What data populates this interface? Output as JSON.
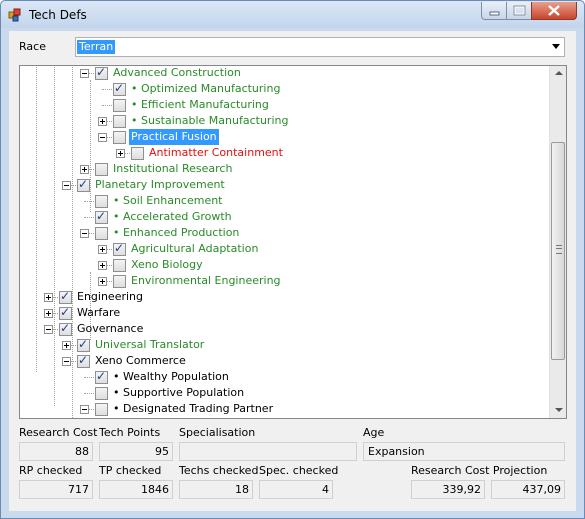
{
  "window": {
    "title": "Tech Defs"
  },
  "race": {
    "label": "Race",
    "value": "Terran"
  },
  "tree_nodes": [
    {
      "text": "Advanced Construction",
      "checked": true,
      "expander": "minus",
      "style": "green"
    },
    {
      "text": "• Optimized Manufacturing",
      "checked": true,
      "expander": "",
      "style": "green"
    },
    {
      "text": "• Efficient Manufacturing",
      "checked": false,
      "expander": "",
      "style": "green"
    },
    {
      "text": "• Sustainable Manufacturing",
      "checked": false,
      "expander": "plus",
      "style": "green"
    },
    {
      "text": "Practical Fusion",
      "checked": false,
      "expander": "minus",
      "style": "selected"
    },
    {
      "text": "Antimatter Containment",
      "checked": false,
      "expander": "plus",
      "style": "red"
    },
    {
      "text": "Institutional Research",
      "checked": false,
      "expander": "plus",
      "style": "green"
    },
    {
      "text": "Planetary Improvement",
      "checked": true,
      "expander": "minus",
      "style": "green"
    },
    {
      "text": "• Soil Enhancement",
      "checked": false,
      "expander": "",
      "style": "green"
    },
    {
      "text": "• Accelerated Growth",
      "checked": true,
      "expander": "",
      "style": "green"
    },
    {
      "text": "• Enhanced Production",
      "checked": false,
      "expander": "minus",
      "style": "green"
    },
    {
      "text": "Agricultural Adaptation",
      "checked": true,
      "expander": "plus",
      "style": "green"
    },
    {
      "text": "Xeno Biology",
      "checked": false,
      "expander": "plus",
      "style": "green"
    },
    {
      "text": "Environmental Engineering",
      "checked": false,
      "expander": "plus",
      "style": "green"
    },
    {
      "text": "Engineering",
      "checked": true,
      "expander": "plus",
      "style": "black"
    },
    {
      "text": "Warfare",
      "checked": true,
      "expander": "plus",
      "style": "black"
    },
    {
      "text": "Governance",
      "checked": true,
      "expander": "minus",
      "style": "black"
    },
    {
      "text": "Universal Translator",
      "checked": true,
      "expander": "plus",
      "style": "green"
    },
    {
      "text": "Xeno Commerce",
      "checked": true,
      "expander": "minus",
      "style": "black"
    },
    {
      "text": "• Wealthy Population",
      "checked": true,
      "expander": "",
      "style": "black"
    },
    {
      "text": "• Supportive Population",
      "checked": false,
      "expander": "",
      "style": "black"
    },
    {
      "text": "• Designated Trading Partner",
      "checked": false,
      "expander": "minus",
      "style": "black"
    }
  ],
  "stats": {
    "research_cost_label": "Research Cost",
    "research_cost": "88",
    "tech_points_label": "Tech Points",
    "tech_points": "95",
    "specialisation_label": "Specialisation",
    "specialisation": "",
    "age_label": "Age",
    "age": "Expansion",
    "rp_checked_label": "RP checked",
    "rp_checked": "717",
    "tp_checked_label": "TP checked",
    "tp_checked": "1846",
    "techs_checked_label": "Techs checked",
    "techs_checked": "18",
    "spec_checked_label": "Spec. checked",
    "spec_checked": "4",
    "projection_label": "Research Cost Projection",
    "projection_1": "339,92",
    "projection_2": "437,09"
  },
  "colors": {
    "green": "#2a8a2a",
    "red": "#e01010",
    "selection": "#3399ff"
  }
}
